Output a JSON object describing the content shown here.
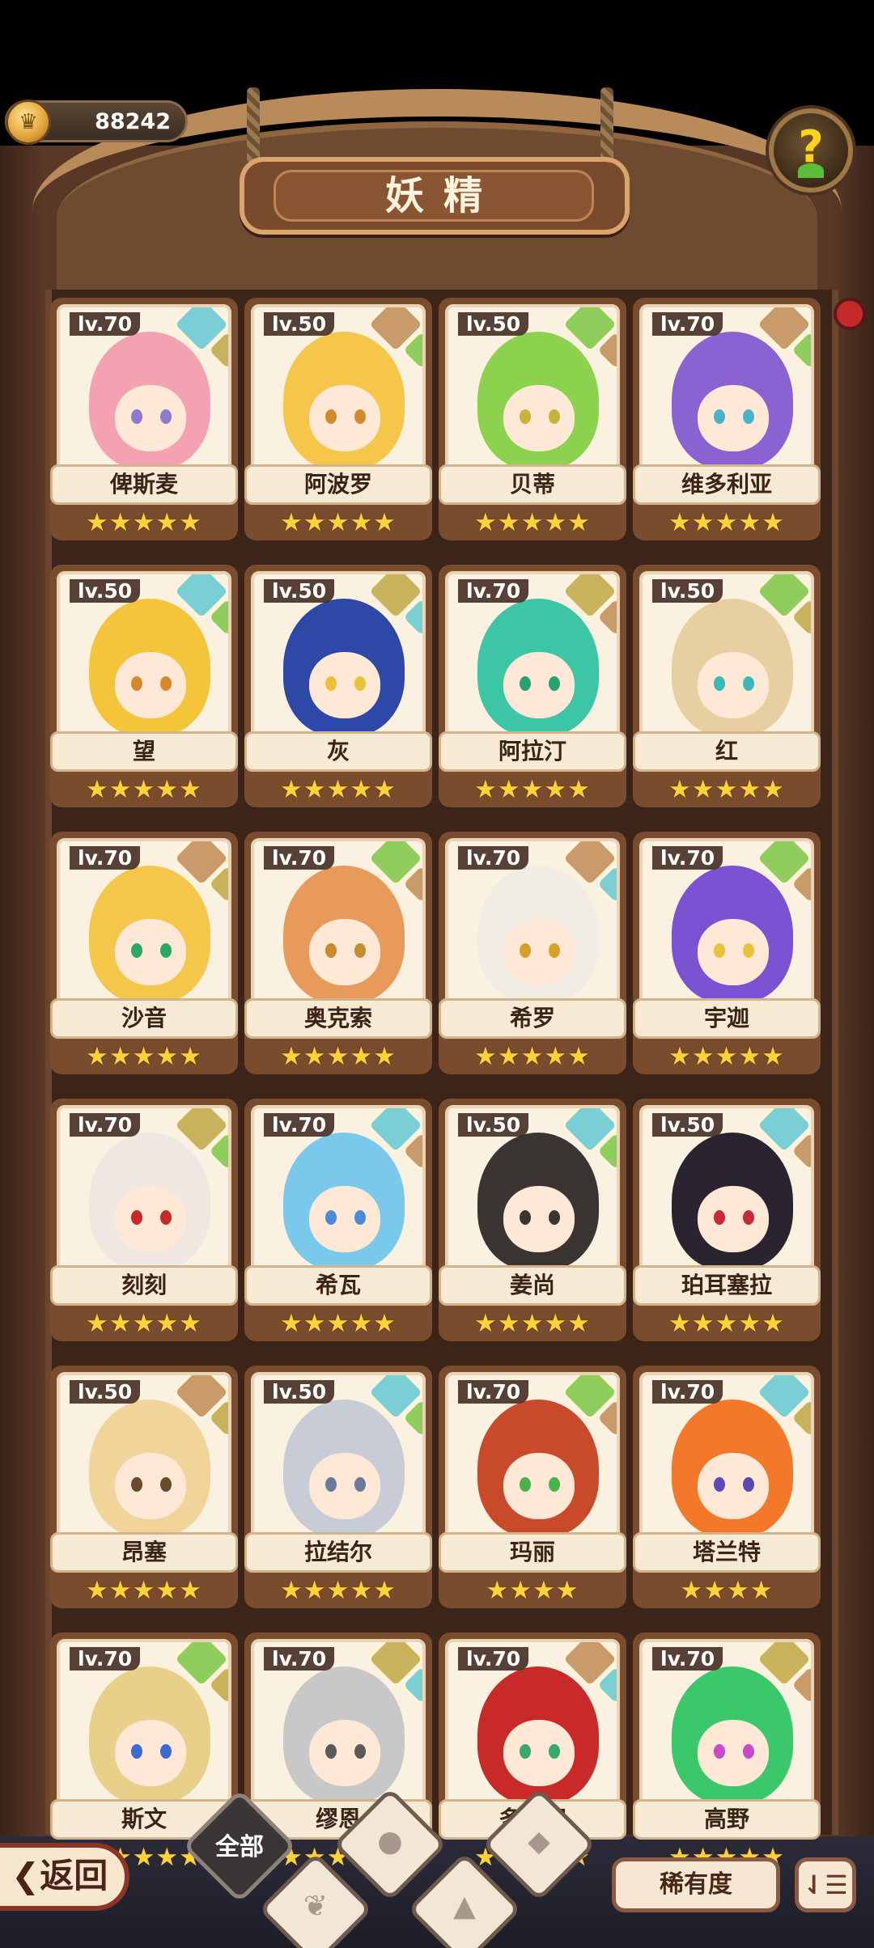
{
  "header": {
    "coin_value": "88242",
    "coin_icon": "crown-coin-icon",
    "title": "妖精",
    "help_label": "?"
  },
  "cards": [
    {
      "level": "lv.70",
      "name": "俾斯麦",
      "stars": "★★★★★",
      "hair": "#f4a2b2",
      "eyes": "#8a7ad0",
      "element": "water",
      "sub": "sand"
    },
    {
      "level": "lv.50",
      "name": "阿波罗",
      "stars": "★★★★★",
      "hair": "#f6c64a",
      "eyes": "#d18a2a",
      "element": "earth",
      "sub": "wood"
    },
    {
      "level": "lv.50",
      "name": "贝蒂",
      "stars": "★★★★★",
      "hair": "#8cd24e",
      "eyes": "#c8b23a",
      "element": "wood",
      "sub": "earth"
    },
    {
      "level": "lv.70",
      "name": "维多利亚",
      "stars": "★★★★★",
      "hair": "#8a62d2",
      "eyes": "#4ab2c8",
      "element": "earth",
      "sub": "wood"
    },
    {
      "level": "lv.50",
      "name": "望",
      "stars": "★★★★★",
      "hair": "#f4c43a",
      "eyes": "#d8882a",
      "element": "water",
      "sub": "wood"
    },
    {
      "level": "lv.50",
      "name": "灰",
      "stars": "★★★★★",
      "hair": "#2e48a8",
      "eyes": "#e8c23a",
      "element": "sand",
      "sub": "water"
    },
    {
      "level": "lv.70",
      "name": "阿拉汀",
      "stars": "★★★★★",
      "hair": "#3cc6a6",
      "eyes": "#2aa070",
      "element": "sand",
      "sub": "earth"
    },
    {
      "level": "lv.50",
      "name": "红",
      "stars": "★★★★★",
      "hair": "#e8cfa2",
      "eyes": "#3cb8b8",
      "element": "wood",
      "sub": "sand"
    },
    {
      "level": "lv.70",
      "name": "沙音",
      "stars": "★★★★★",
      "hair": "#f4c64a",
      "eyes": "#2aa868",
      "element": "earth",
      "sub": "sand"
    },
    {
      "level": "lv.70",
      "name": "奥克索",
      "stars": "★★★★★",
      "hair": "#e89a5a",
      "eyes": "#c88a2a",
      "element": "wood",
      "sub": "earth"
    },
    {
      "level": "lv.70",
      "name": "希罗",
      "stars": "★★★★★",
      "hair": "#f2ede4",
      "eyes": "#d8a02a",
      "element": "earth",
      "sub": "water"
    },
    {
      "level": "lv.70",
      "name": "宇迦",
      "stars": "★★★★★",
      "hair": "#7a52d2",
      "eyes": "#e8c23a",
      "element": "wood",
      "sub": "earth"
    },
    {
      "level": "lv.70",
      "name": "刻刻",
      "stars": "★★★★★",
      "hair": "#efe8e2",
      "eyes": "#c82a2a",
      "element": "sand",
      "sub": "wood"
    },
    {
      "level": "lv.70",
      "name": "希瓦",
      "stars": "★★★★★",
      "hair": "#7ac8ec",
      "eyes": "#4a8ad8",
      "element": "water",
      "sub": "earth"
    },
    {
      "level": "lv.50",
      "name": "姜尚",
      "stars": "★★★★★",
      "hair": "#3a3432",
      "eyes": "#3a3432",
      "element": "water",
      "sub": "wood"
    },
    {
      "level": "lv.50",
      "name": "珀耳塞拉",
      "stars": "★★★★★",
      "hair": "#2a2430",
      "eyes": "#c82a3a",
      "element": "water",
      "sub": "earth"
    },
    {
      "level": "lv.50",
      "name": "昂塞",
      "stars": "★★★★★",
      "hair": "#f0d49a",
      "eyes": "#6a4a2a",
      "element": "earth",
      "sub": "sand"
    },
    {
      "level": "lv.50",
      "name": "拉结尔",
      "stars": "★★★★★",
      "hair": "#c8ccd6",
      "eyes": "#6a7a9a",
      "element": "water",
      "sub": "wood"
    },
    {
      "level": "lv.70",
      "name": "玛丽",
      "stars": "★★★★",
      "hair": "#c84a2a",
      "eyes": "#4ab24a",
      "element": "wood",
      "sub": "earth"
    },
    {
      "level": "lv.70",
      "name": "塔兰特",
      "stars": "★★★★",
      "hair": "#f4782a",
      "eyes": "#5a4ab2",
      "element": "water",
      "sub": "sand"
    },
    {
      "level": "lv.70",
      "name": "斯文",
      "stars": "★★★★★",
      "hair": "#e8cf8a",
      "eyes": "#3a6ad2",
      "element": "wood",
      "sub": "sand"
    },
    {
      "level": "lv.70",
      "name": "缪恩",
      "stars": "★★★★★",
      "hair": "#c8c8c8",
      "eyes": "#5a5a5a",
      "element": "sand",
      "sub": "water"
    },
    {
      "level": "lv.70",
      "name": "多…印",
      "stars": "★★★★★",
      "hair": "#c82a2a",
      "eyes": "#3aa86a",
      "element": "earth",
      "sub": "water"
    },
    {
      "level": "lv.70",
      "name": "高野",
      "stars": "★★★★★",
      "hair": "#3ac86a",
      "eyes": "#c84ac8",
      "element": "sand",
      "sub": "earth"
    }
  ],
  "footer": {
    "back_label": "❮返回",
    "filter_all_label": "全部",
    "filter_icons": [
      "sprout-filter-icon",
      "water-drop-filter-icon",
      "mountain-filter-icon",
      "earth-filter-icon"
    ],
    "rarity_label": "稀有度",
    "sort_label": "⇃☰"
  },
  "colors": {
    "wood_dark": "#3c2418",
    "wood_light": "#b98a5a",
    "card_face": "#fbf1e1",
    "star": "#ffd23a"
  }
}
